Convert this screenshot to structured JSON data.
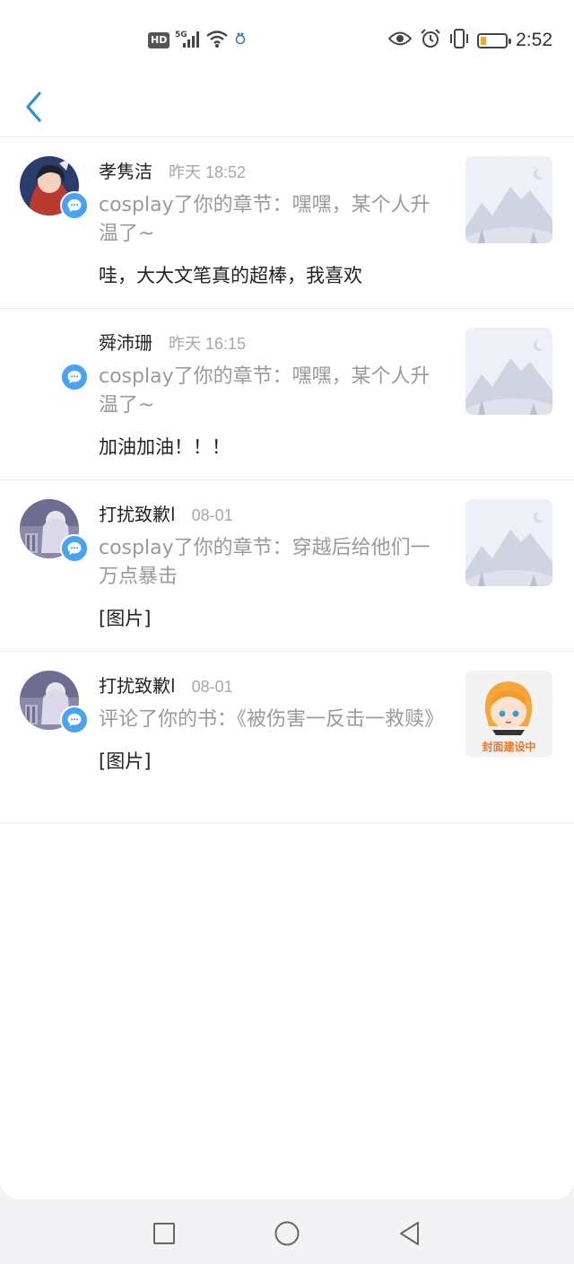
{
  "status_bar": {
    "hd": "HD",
    "network": "5G",
    "time": "2:52",
    "battery_level_pct": 22,
    "battery_color": "#f5a623"
  },
  "navbar": {
    "back_icon": "chevron-left-icon",
    "accent": "#2b8fe0"
  },
  "notifications": [
    {
      "name": "孝隽洁",
      "time": "昨天 18:52",
      "desc": "cosplay了你的章节：嘿嘿，某个人升温了~",
      "comment": "哇，大大文笔真的超棒，我喜欢",
      "has_avatar": true,
      "thumb": "mountain"
    },
    {
      "name": "舜沛珊",
      "time": "昨天 16:15",
      "desc": "cosplay了你的章节：嘿嘿，某个人升温了~",
      "comment": "加油加油！！！",
      "has_avatar": false,
      "thumb": "mountain"
    },
    {
      "name": "打扰致歉l",
      "time": "08-01",
      "desc": "cosplay了你的章节：穿越后给他们一万点暴击",
      "comment": "[图片]",
      "has_avatar": true,
      "thumb": "mountain"
    },
    {
      "name": "打扰致歉l",
      "time": "08-01",
      "desc": "评论了你的书：《被伤害一反击一救赎》",
      "comment": "[图片]",
      "has_avatar": true,
      "thumb": "cover",
      "thumb_text": "封面建设中"
    }
  ],
  "system_nav": {
    "recent": "square-icon",
    "home": "circle-icon",
    "back": "triangle-back-icon"
  }
}
